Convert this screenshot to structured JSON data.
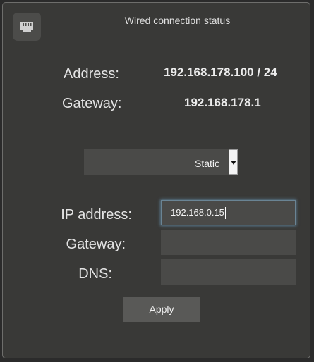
{
  "window": {
    "title": "Wired connection status",
    "icon": "ethernet-port-icon"
  },
  "status": {
    "address_label": "Address:",
    "address_value": "192.168.178.100 / 24",
    "gateway_label": "Gateway:",
    "gateway_value": "192.168.178.1"
  },
  "mode": {
    "selected": "Static"
  },
  "form": {
    "ip_label": "IP address:",
    "ip_value": "192.168.0.15",
    "gateway_label": "Gateway:",
    "gateway_value": "",
    "dns_label": "DNS:",
    "dns_value": ""
  },
  "actions": {
    "apply_label": "Apply"
  },
  "colors": {
    "background": "#393937",
    "field": "#4a4a48",
    "button": "#595957",
    "focus_ring": "#6a8494"
  }
}
